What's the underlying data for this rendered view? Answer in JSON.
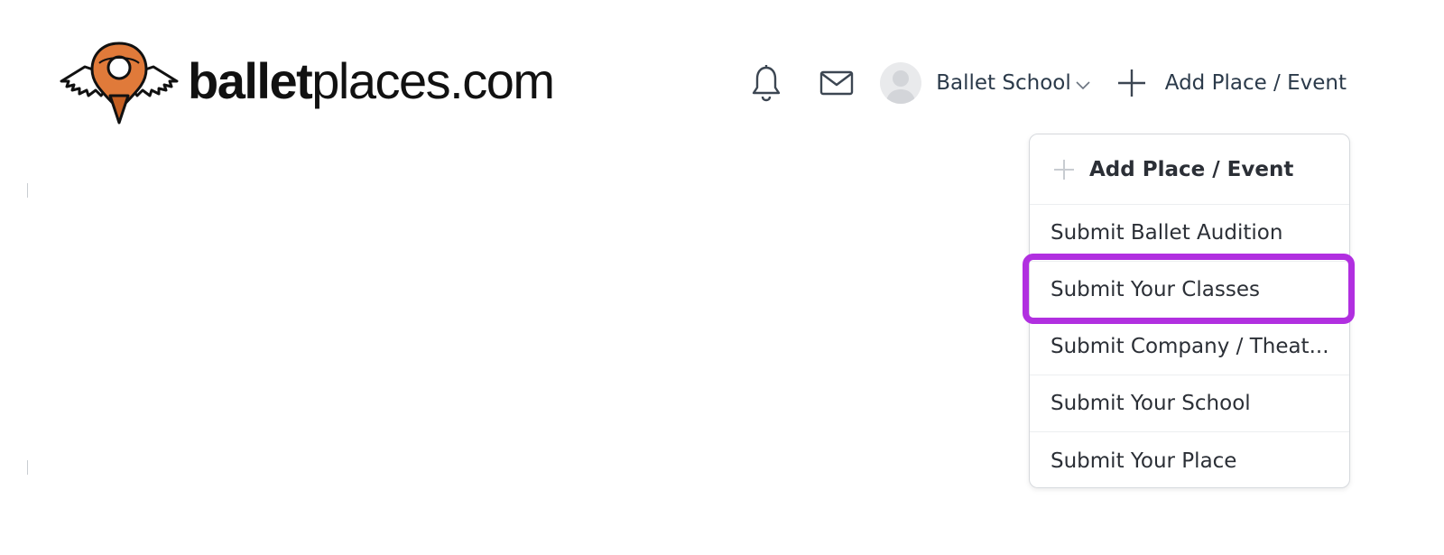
{
  "logo": {
    "text_bold": "ballet",
    "text_light": "places.com",
    "icon": "map-pin-with-wings-icon",
    "colors": {
      "pin": "#e07a3a",
      "pin_dark": "#c45f22",
      "ink": "#111111"
    }
  },
  "header": {
    "notifications_icon": "bell-icon",
    "messages_icon": "envelope-icon",
    "account": {
      "avatar_icon": "user-avatar-icon",
      "label": "Ballet School",
      "caret_icon": "chevron-down-icon"
    },
    "add": {
      "icon": "plus-icon",
      "label": "Add Place / Event"
    }
  },
  "dropdown": {
    "header_icon": "plus-icon",
    "title": "Add Place / Event",
    "items": [
      {
        "label": "Submit Ballet Audition"
      },
      {
        "label": "Submit Your Classes",
        "highlighted": true
      },
      {
        "label": "Submit Company / Theat..."
      },
      {
        "label": "Submit Your School"
      },
      {
        "label": "Submit Your Place"
      }
    ]
  },
  "highlight_color": "#b12fe0"
}
